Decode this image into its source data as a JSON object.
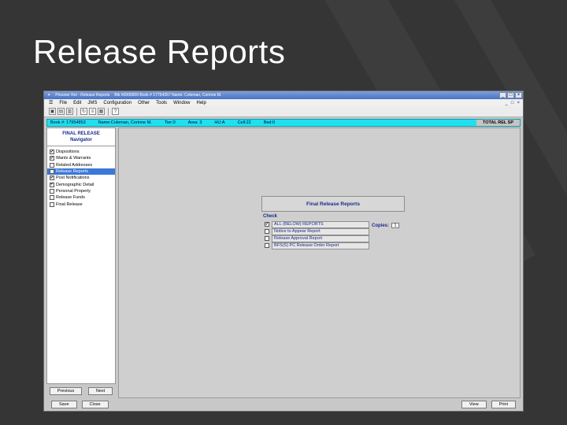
{
  "slide": {
    "title": "Release Reports"
  },
  "window": {
    "title": "Prisoner Rel - Release Reports",
    "subtitle": "Blk #0000000  Book # 17754357  Name: Coleman, Corinne M.",
    "controls": [
      "_",
      "□",
      "×"
    ]
  },
  "menubar": {
    "items": [
      "File",
      "Edit",
      "JMS",
      "Configuration",
      "Other",
      "Tools",
      "Window",
      "Help"
    ],
    "window_controls": [
      "_",
      "□",
      "×"
    ]
  },
  "toolbar": {
    "icons": [
      "save-icon",
      "open-icon",
      "print-icon",
      "refresh-icon",
      "list-icon",
      "window-icon",
      "help-icon"
    ]
  },
  "infobar": {
    "book": "Book #: 17954853",
    "name": "Name:Coleman, Corinne M.",
    "tier": "Tier:0",
    "area": "Area: 3",
    "hu": "HU:A",
    "cell": "Cell:22",
    "bed": "Bed:0",
    "mode": "TOTAL REL SP"
  },
  "navigator": {
    "title_line1": "FINAL RELEASE",
    "title_line2": "Navigator",
    "items": [
      {
        "label": "Dispositions",
        "checked": "✔"
      },
      {
        "label": "Wants & Warrants",
        "checked": "✔"
      },
      {
        "label": "Related Addresses",
        "checked": ""
      },
      {
        "label": "Release Reports",
        "checked": ""
      },
      {
        "label": "Post Notifications",
        "checked": "✔"
      },
      {
        "label": "Demographic Detail",
        "checked": "✔"
      },
      {
        "label": "Personal Property",
        "checked": ""
      },
      {
        "label": "Release Funds",
        "checked": ""
      },
      {
        "label": "Final Release",
        "checked": ""
      }
    ],
    "previous_label": "Previous",
    "next_label": "Next"
  },
  "report_panel": {
    "title": "Final Release Reports",
    "check_label": "Check",
    "reports": [
      {
        "label": "ALL (BELOW) REPORTS",
        "checked": "✔"
      },
      {
        "label": "Notice to Appear Report",
        "checked": ""
      },
      {
        "label": "Release Approval Report",
        "checked": ""
      },
      {
        "label": "BFS(S) PC Release Order Report",
        "checked": ""
      }
    ],
    "copies_label": "Copies:",
    "copies_value": "1"
  },
  "bottom": {
    "save_label": "Save",
    "close_label": "Close",
    "view_label": "View",
    "print_label": "Print"
  },
  "colors": {
    "infobar": "#1fe0f0",
    "selected": "#3b78d8",
    "title_blue": "#1b2a8c"
  }
}
